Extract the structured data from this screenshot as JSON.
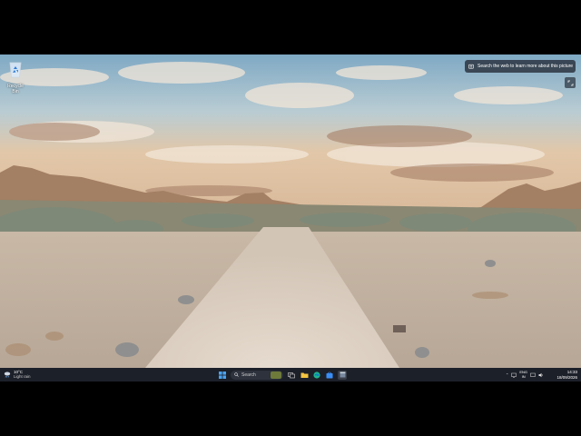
{
  "desktop": {
    "icons": [
      {
        "label": "Recycle Bin",
        "icon": "recycle-bin-icon"
      }
    ],
    "spotlight": {
      "label": "Search the web to learn more about this picture",
      "icon": "camera-icon",
      "expand_icon": "expand-icon"
    }
  },
  "taskbar": {
    "weather": {
      "temp": "10°C",
      "condition": "Light rain",
      "icon": "cloud-rain-icon"
    },
    "start_icon": "windows-logo-icon",
    "search": {
      "placeholder": "Search",
      "icon": "search-icon"
    },
    "pinned": [
      {
        "name": "task-view",
        "icon": "task-view-icon"
      },
      {
        "name": "file-explorer",
        "icon": "folder-icon",
        "color": "#f4c542"
      },
      {
        "name": "edge",
        "icon": "edge-icon",
        "color": "#1fb58f"
      },
      {
        "name": "microsoft-store",
        "icon": "store-icon",
        "color": "#3a8ef6"
      },
      {
        "name": "app",
        "icon": "window-app-icon",
        "color": "#7a8aa0"
      }
    ],
    "tray": {
      "language": "ENG",
      "region": "IN"
    },
    "clock": {
      "time": "14:33",
      "date": "18/09/2026"
    }
  }
}
